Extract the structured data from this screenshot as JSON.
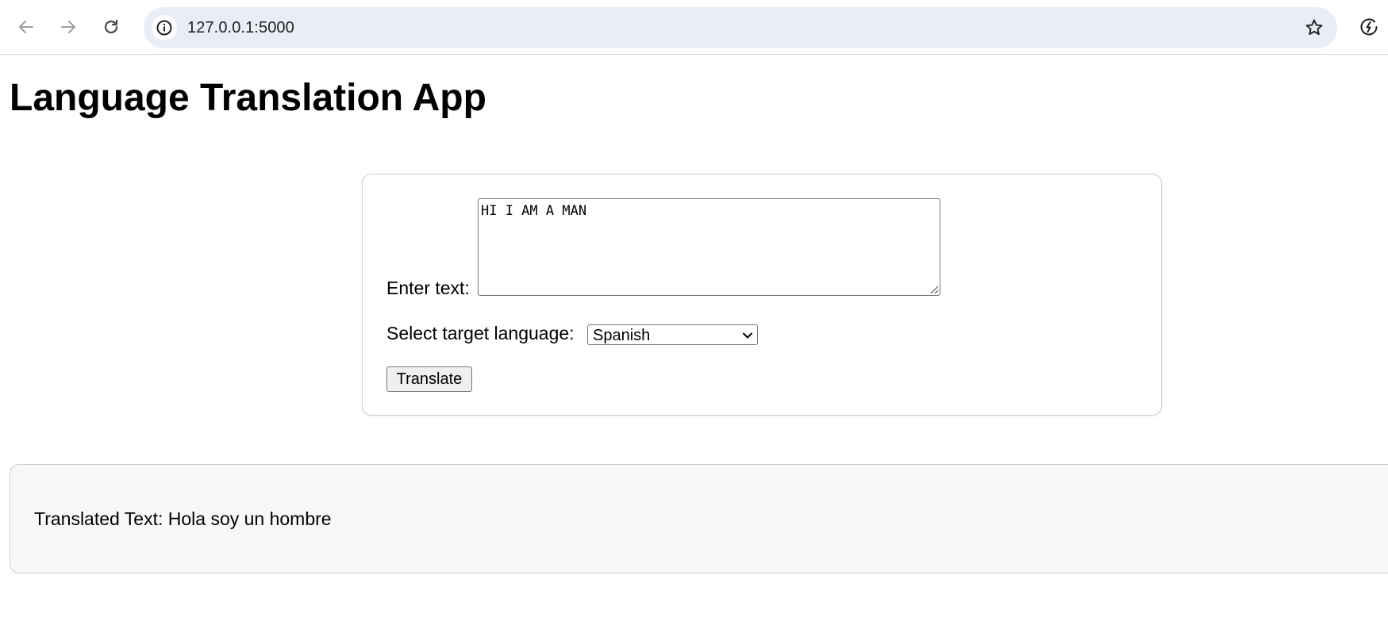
{
  "browser": {
    "url": "127.0.0.1:5000",
    "icons": {
      "back": "arrow-left-icon",
      "forward": "arrow-right-icon",
      "reload": "reload-icon",
      "site_info": "info-icon",
      "bookmark": "star-icon",
      "extension": "energy-saver-icon"
    }
  },
  "page": {
    "title": "Language Translation App"
  },
  "form": {
    "text_label": "Enter text:",
    "text_value": "HI I AM A MAN",
    "language_label": "Select target language:",
    "language_selected": "Spanish",
    "submit_label": "Translate"
  },
  "result": {
    "prefix": "Translated Text:",
    "value": "Hola soy un hombre"
  },
  "colors": {
    "omnibox_bg": "#e9edf6",
    "result_bg": "#f8f8f8",
    "button_bg": "#efefef"
  }
}
